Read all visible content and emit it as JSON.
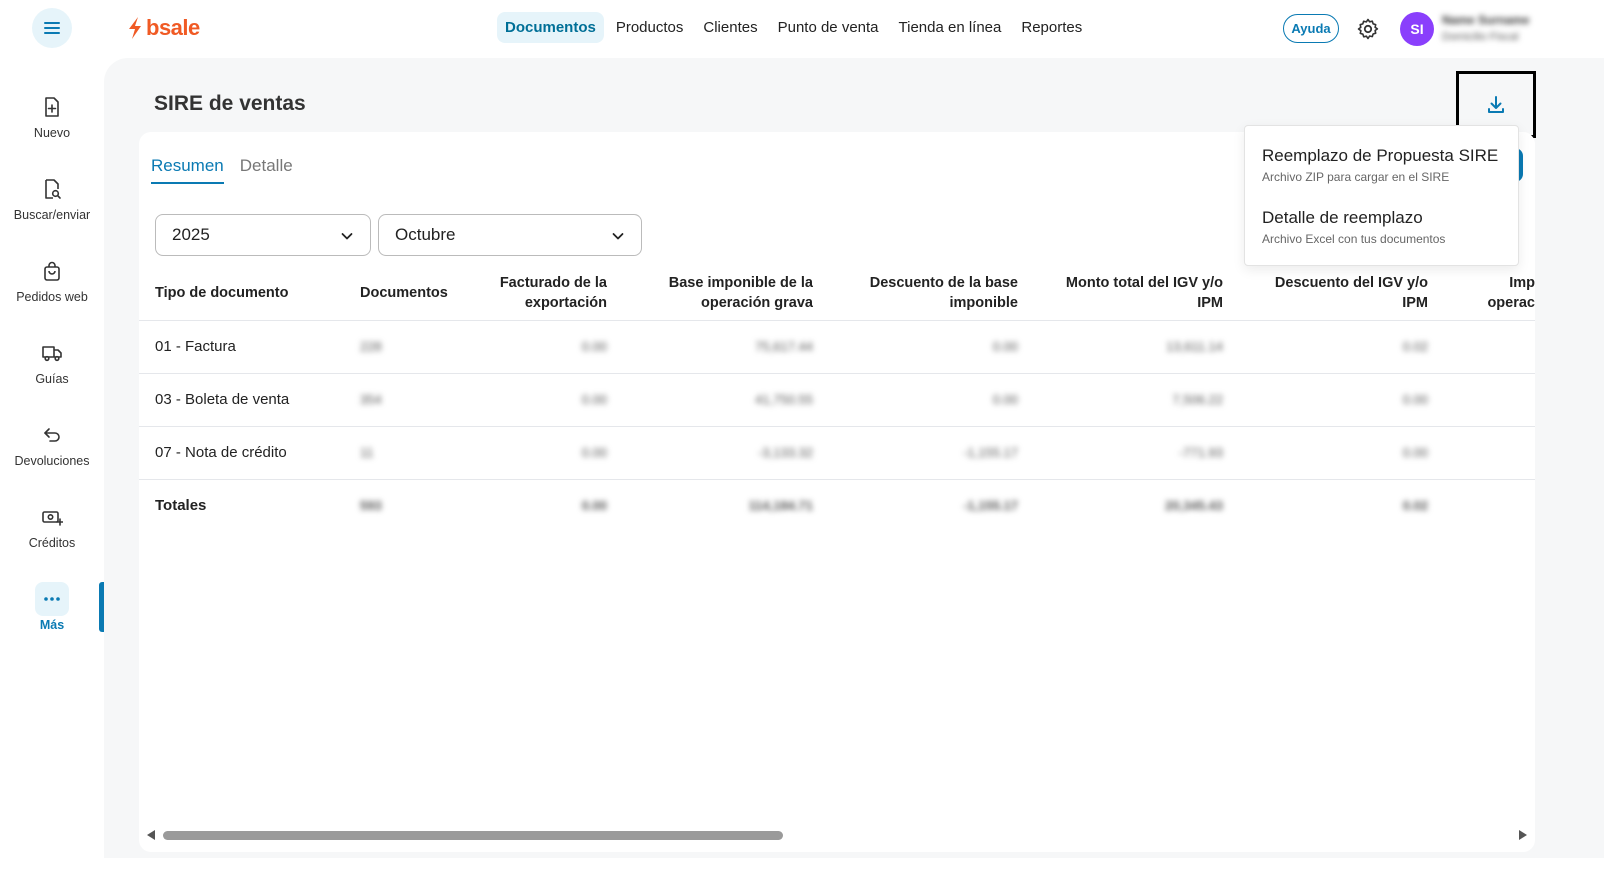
{
  "header": {
    "logo_text": "bsale",
    "nav": [
      "Documentos",
      "Productos",
      "Clientes",
      "Punto de venta",
      "Tienda en línea",
      "Reportes"
    ],
    "help_label": "Ayuda",
    "avatar_initials": "SI",
    "user_name": "Name Surname",
    "user_sub": "Domicilio Fiscal"
  },
  "sidebar": {
    "items": [
      {
        "label": "Nuevo",
        "icon": "file-plus-icon"
      },
      {
        "label": "Buscar/enviar",
        "icon": "file-search-icon"
      },
      {
        "label": "Pedidos web",
        "icon": "shopping-bag-icon"
      },
      {
        "label": "Guías",
        "icon": "truck-icon"
      },
      {
        "label": "Devoluciones",
        "icon": "return-arrow-icon"
      },
      {
        "label": "Créditos",
        "icon": "cash-plus-icon"
      },
      {
        "label": "Más",
        "icon": "more-dots-icon"
      }
    ]
  },
  "page": {
    "title": "SIRE de ventas",
    "tabs": [
      "Resumen",
      "Detalle"
    ],
    "year": "2025",
    "month": "Octubre"
  },
  "table": {
    "headers": [
      [
        "Tipo de documento"
      ],
      [
        "Documentos"
      ],
      [
        "Facturado de la",
        "exportación"
      ],
      [
        "Base imponible de la",
        "operación grava"
      ],
      [
        "Descuento de la base",
        "imponible"
      ],
      [
        "Monto total del IGV y/o",
        "IPM"
      ],
      [
        "Descuento del IGV y/o",
        "IPM"
      ],
      [
        "Imp",
        "operac"
      ]
    ],
    "rows": [
      {
        "tipo": "01 - Factura",
        "values": [
          "228",
          "0.00",
          "75,617.44",
          "0.00",
          "13,611.14",
          "0.02"
        ]
      },
      {
        "tipo": "03 - Boleta de venta",
        "values": [
          "354",
          "0.00",
          "41,750.55",
          "0.00",
          "7,506.22",
          "0.00"
        ]
      },
      {
        "tipo": "07 - Nota de crédito",
        "values": [
          "11",
          "0.00",
          "-3,133.32",
          "-1,155.17",
          "-771.93",
          "0.00"
        ]
      },
      {
        "tipo": "Totales",
        "values": [
          "593",
          "0.00",
          "114,184.71",
          "-1,155.17",
          "20,345.43",
          "0.02"
        ]
      }
    ]
  },
  "download_menu": {
    "items": [
      {
        "title": "Reemplazo de Propuesta SIRE",
        "subtitle": "Archivo ZIP para cargar en el SIRE"
      },
      {
        "title": "Detalle de reemplazo",
        "subtitle": "Archivo Excel con tus documentos"
      }
    ]
  },
  "colors": {
    "brand": "#f05a24",
    "accent": "#0a7ab3",
    "avatar": "#8a3ffc"
  }
}
